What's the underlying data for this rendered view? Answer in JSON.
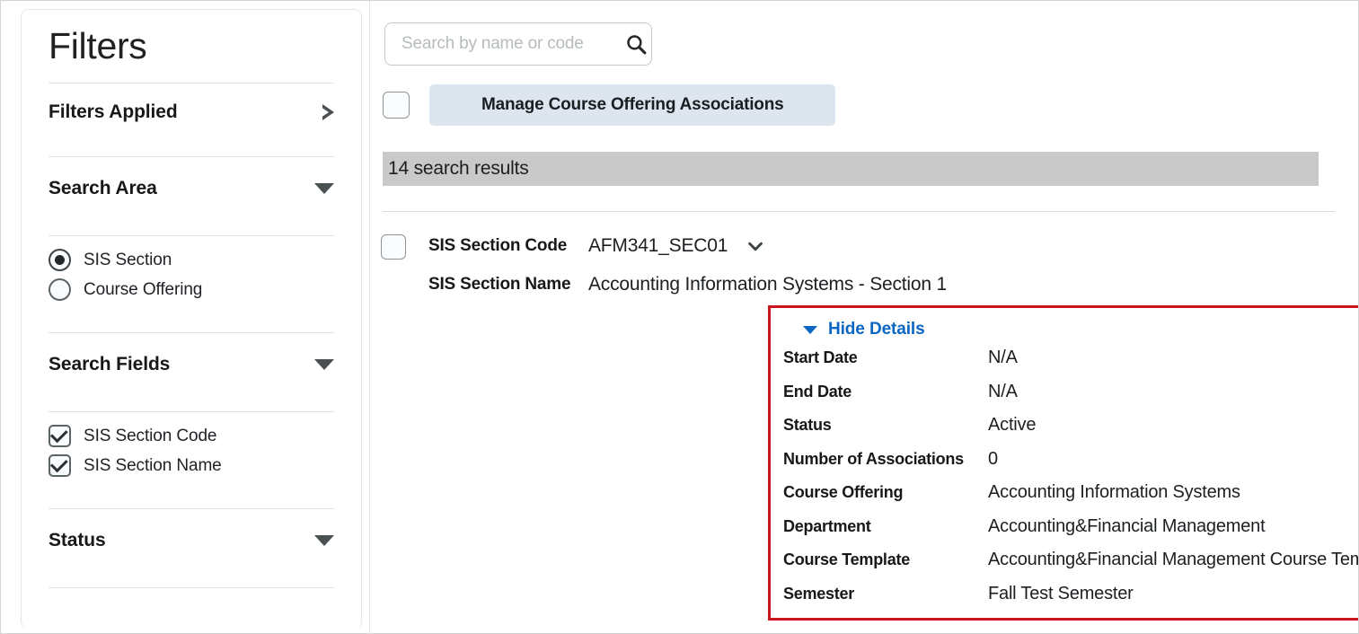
{
  "sidebar": {
    "title": "Filters",
    "filters_applied": {
      "label": "Filters Applied",
      "icon": "triangle-right-icon",
      "expanded": false
    },
    "sections": [
      {
        "key": "search_area",
        "title": "Search Area",
        "icon": "triangle-down-icon",
        "type": "radio",
        "options": [
          {
            "label": "SIS Section",
            "selected": true
          },
          {
            "label": "Course Offering",
            "selected": false
          }
        ]
      },
      {
        "key": "search_fields",
        "title": "Search Fields",
        "icon": "triangle-down-icon",
        "type": "checkbox",
        "options": [
          {
            "label": "SIS Section Code",
            "checked": true
          },
          {
            "label": "SIS Section Name",
            "checked": true
          }
        ]
      },
      {
        "key": "status",
        "title": "Status",
        "icon": "triangle-down-icon",
        "type": "checkbox",
        "options": []
      }
    ]
  },
  "main": {
    "search": {
      "value": "",
      "placeholder": "Search by name or code",
      "icon": "search-icon"
    },
    "bulk": {
      "checkbox_checked": false,
      "button_label": "Manage Course Offering Associations"
    },
    "results_bar": {
      "text": "14 search results"
    },
    "result": {
      "checkbox_checked": false,
      "code_label": "SIS Section Code",
      "code_value": "AFM341_SEC01",
      "chevron_icon": "chevron-down-icon",
      "name_label": "SIS Section Name",
      "name_value": "Accounting Information Systems - Section 1",
      "details": {
        "toggle_label": "Hide Details",
        "toggle_icon": "triangle-down-icon",
        "rows": [
          {
            "label": "Start Date",
            "value": "N/A"
          },
          {
            "label": "End Date",
            "value": "N/A"
          },
          {
            "label": "Status",
            "value": "Active"
          },
          {
            "label": "Number of Associations",
            "value": "0"
          },
          {
            "label": "Course Offering",
            "value": "Accounting Information Systems"
          },
          {
            "label": "Department",
            "value": "Accounting&Financial Management"
          },
          {
            "label": "Course Template",
            "value": "Accounting&Financial Management Course Template"
          },
          {
            "label": "Semester",
            "value": "Fall Test Semester"
          }
        ]
      }
    }
  },
  "colors": {
    "highlight_border": "#c9161d",
    "link": "#0a66c2",
    "results_bar_bg": "#c9c9c9",
    "button_bg": "#dde5ef"
  }
}
